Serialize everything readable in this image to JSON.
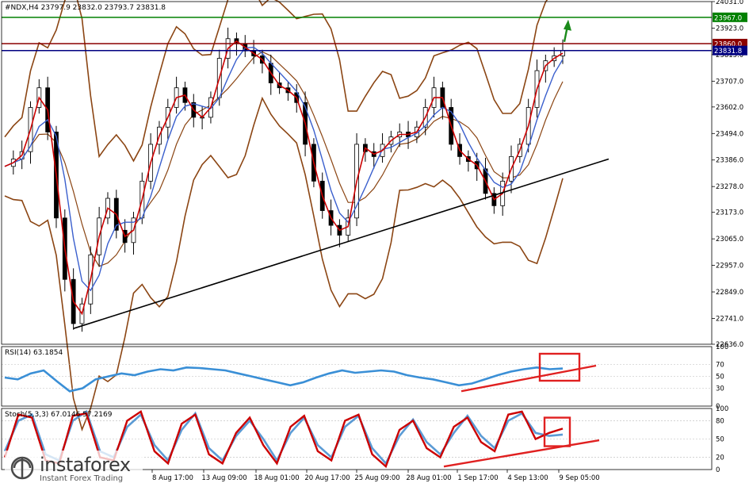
{
  "chart_data": [
    {
      "type": "line",
      "subtype": "candlestick",
      "title": "#NDX,H4  23797.9 23832.0 23793.7 23831.8",
      "header": {
        "symbol_timeframe": "#NDX,H4",
        "open": "23797.9",
        "high": "23832.0",
        "low": "23793.7",
        "close": "23831.8"
      },
      "ylim": [
        22636.0,
        24031.0
      ],
      "yticks": [
        "24031.0",
        "23923.0",
        "23815.0",
        "23707.0",
        "23602.0",
        "23494.0",
        "23386.0",
        "23278.0",
        "23173.0",
        "23065.0",
        "22957.0",
        "22849.0",
        "22741.0",
        "22636.0"
      ],
      "x_tick_labels": [
        "8 Aug 17:00",
        "13 Aug 09:00",
        "18 Aug 01:00",
        "20 Aug 17:00",
        "25 Aug 09:00",
        "28 Aug 01:00",
        "1 Sep 17:00",
        "4 Sep 13:00",
        "9 Sep 05:00"
      ],
      "price_levels": [
        {
          "value": "23967.0",
          "color": "#008000"
        },
        {
          "value": "23860.0",
          "color": "#8b0000"
        },
        {
          "value": "23831.8",
          "color": "#000080"
        }
      ],
      "close_path": [
        23360,
        23390,
        23420,
        23600,
        23680,
        23500,
        23150,
        22900,
        22720,
        22800,
        23000,
        23150,
        23230,
        23100,
        23050,
        23150,
        23300,
        23450,
        23520,
        23600,
        23680,
        23620,
        23560,
        23560,
        23640,
        23800,
        23880,
        23860,
        23830,
        23810,
        23780,
        23700,
        23680,
        23660,
        23620,
        23450,
        23300,
        23180,
        23120,
        23080,
        23150,
        23450,
        23420,
        23400,
        23450,
        23480,
        23500,
        23480,
        23520,
        23600,
        23680,
        23600,
        23450,
        23400,
        23380,
        23350,
        23250,
        23200,
        23300,
        23400,
        23450,
        23600,
        23750,
        23790,
        23810,
        23831.8
      ],
      "series": [
        {
          "name": "",
          "color": "#cc0000",
          "role": "fast moving average"
        },
        {
          "name": "",
          "color": "#3a5fcd",
          "role": "slow moving average"
        },
        {
          "name": "",
          "color": "#8b4513",
          "role": "bollinger bands"
        }
      ],
      "annotations": [
        "ascending trendline",
        "green arrow up"
      ]
    },
    {
      "type": "line",
      "title": "RSI(14) 63.1854",
      "ylim": [
        0,
        100
      ],
      "yticks": [
        "100",
        "70",
        "50",
        "30",
        "0"
      ],
      "series": [
        {
          "name": "",
          "color": "#3a8fd6",
          "values": [
            48,
            45,
            55,
            60,
            42,
            25,
            30,
            45,
            50,
            55,
            52,
            58,
            62,
            60,
            65,
            64,
            62,
            60,
            55,
            50,
            45,
            40,
            35,
            40,
            48,
            55,
            60,
            56,
            58,
            60,
            58,
            52,
            48,
            45,
            40,
            35,
            38,
            45,
            52,
            58,
            62,
            65,
            62,
            63.1854
          ]
        }
      ],
      "annotations": [
        "rising trendline",
        "highlight box"
      ]
    },
    {
      "type": "line",
      "title": "Stoch(5,3,3) 67.0146 57.2169",
      "ylim": [
        0,
        100
      ],
      "yticks": [
        "100",
        "80",
        "50",
        "20",
        "0"
      ],
      "series": [
        {
          "name": "",
          "color": "#cc0000",
          "values": [
            20,
            90,
            85,
            15,
            10,
            88,
            92,
            20,
            15,
            80,
            95,
            30,
            10,
            75,
            90,
            25,
            10,
            60,
            85,
            40,
            10,
            70,
            88,
            30,
            15,
            80,
            90,
            25,
            5,
            65,
            80,
            35,
            20,
            70,
            85,
            45,
            30,
            90,
            95,
            50,
            60,
            67.0146
          ]
        },
        {
          "name": "",
          "color": "#5b9bd5",
          "values": [
            30,
            80,
            90,
            25,
            15,
            80,
            95,
            30,
            20,
            70,
            90,
            40,
            15,
            65,
            92,
            35,
            15,
            55,
            80,
            50,
            15,
            60,
            85,
            40,
            20,
            70,
            88,
            35,
            10,
            55,
            82,
            45,
            25,
            60,
            88,
            55,
            35,
            80,
            92,
            60,
            55,
            57.2169
          ]
        }
      ],
      "annotations": [
        "rising trendline",
        "highlight box"
      ]
    }
  ],
  "watermark": {
    "name": "instaforex",
    "tagline": "Instant Forex Trading"
  }
}
